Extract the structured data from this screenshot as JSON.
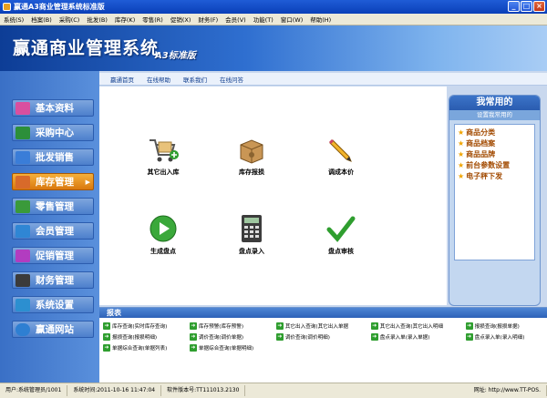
{
  "window": {
    "title": "赢通A3商业管理系统标准版"
  },
  "menu": [
    "系统(S)",
    "档案(B)",
    "采购(C)",
    "批发(B)",
    "库存(K)",
    "零售(R)",
    "促销(X)",
    "财务(F)",
    "会员(V)",
    "功能(T)",
    "窗口(W)",
    "帮助(H)"
  ],
  "banner": {
    "title": "赢通商业管理系统",
    "edition": "A3标准版"
  },
  "subnav": [
    "赢通首页",
    "在线帮助",
    "联系我们",
    "在线问答"
  ],
  "sidebar": [
    "基本资料",
    "采购中心",
    "批发销售",
    "库存管理",
    "零售管理",
    "会员管理",
    "促销管理",
    "财务管理",
    "系统设置",
    "赢通网站"
  ],
  "functions": [
    "其它出入库",
    "库存报损",
    "调成本价",
    "生成盘点",
    "盘点录入",
    "盘点审核"
  ],
  "favorites": {
    "title": "我常用的",
    "setting": "设置我常用的",
    "items": [
      "商品分类",
      "商品档案",
      "商品品牌",
      "前台参数设置",
      "电子秤下发"
    ]
  },
  "report": {
    "title": "报表",
    "items": [
      "库存查询(实时库存查询)",
      "库存预警(库存预警)",
      "其它出入查询(其它出入单据",
      "其它出入查询(其它出入明细",
      "报损查询(报损单据)",
      "报损查询(报损明细)",
      "调价查询(调价单据)",
      "调价查询(调价明细)",
      "盘点录入单(录入单据)",
      "盘点录入单(录入明细)",
      "单据综合查询(单据列表)",
      "单据综合查询(单据明细)"
    ]
  },
  "status": {
    "user": "用户:系统管理员/1001",
    "time": "系统时间:2011-10-16 11:47:04",
    "version": "软件版本号:TT111013.2130",
    "site": "网址: http://www.TT-POS."
  }
}
